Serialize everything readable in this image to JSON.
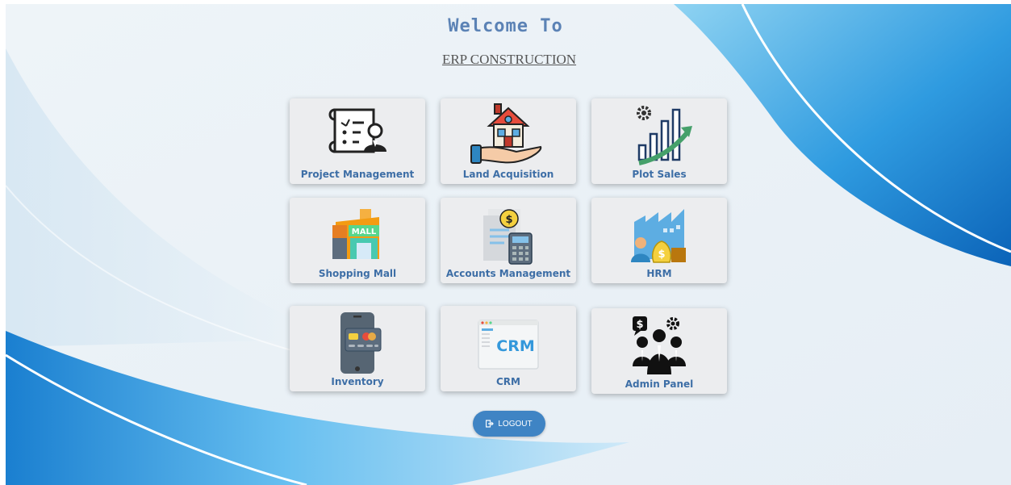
{
  "header": {
    "title": "Welcome To",
    "subtitle": "ERP CONSTRUCTION"
  },
  "modules": [
    {
      "label": "Project Management",
      "icon": "project-management-icon"
    },
    {
      "label": "Land Acquisition",
      "icon": "land-acquisition-icon"
    },
    {
      "label": "Plot Sales",
      "icon": "plot-sales-icon"
    },
    {
      "label": "Shopping Mall",
      "icon": "shopping-mall-icon"
    },
    {
      "label": "Accounts Management",
      "icon": "accounts-management-icon"
    },
    {
      "label": "HRM",
      "icon": "hrm-icon"
    },
    {
      "label": "Inventory",
      "icon": "inventory-icon"
    },
    {
      "label": "CRM",
      "icon": "crm-icon",
      "icon_text": "CRM"
    },
    {
      "label": "Admin Panel",
      "icon": "admin-panel-icon"
    }
  ],
  "logout": {
    "label": "LOGOUT",
    "icon": "logout-icon"
  },
  "colors": {
    "title": "#5b82b5",
    "label": "#3d6ea6",
    "card": "#ecedef",
    "button": "#3f84c4",
    "wave": "#1e88d8"
  }
}
